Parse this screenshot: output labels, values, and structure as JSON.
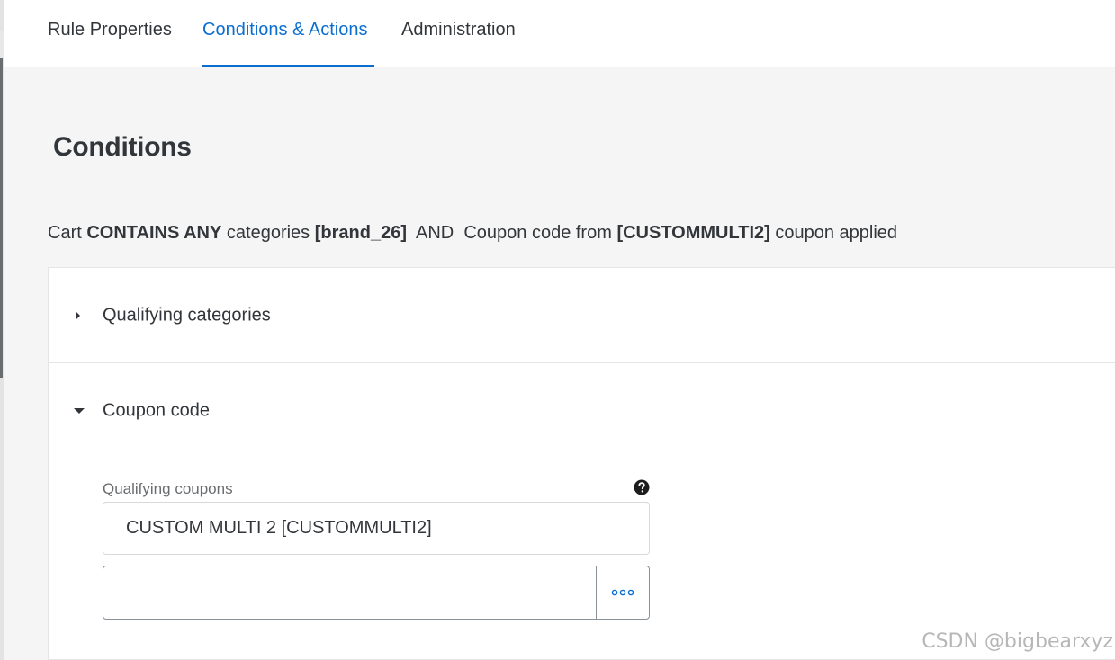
{
  "tabs": [
    {
      "label": "Rule Properties",
      "active": false
    },
    {
      "label": "Conditions & Actions",
      "active": true
    },
    {
      "label": "Administration",
      "active": false
    }
  ],
  "section": {
    "title": "Conditions"
  },
  "summary": {
    "p1": "Cart ",
    "b1": "CONTAINS ANY",
    "p2": " categories ",
    "b2": "[brand_26]",
    "p3": "  AND  Coupon code from ",
    "b3": "[CUSTOMMULTI2]",
    "p4": " coupon applied"
  },
  "groups": [
    {
      "label": "Qualifying categories",
      "expanded": false
    },
    {
      "label": "Coupon code",
      "expanded": true
    }
  ],
  "coupon": {
    "field_label": "Qualifying coupons",
    "selected_value": "CUSTOM MULTI 2 [CUSTOMMULTI2]",
    "input_value": "",
    "more_icon": "ellipsis-icon",
    "help_icon": "question-circle-icon"
  },
  "watermark": "CSDN @bigbearxyz",
  "colors": {
    "accent": "#0a6ed1",
    "text": "#32363a",
    "background": "#f5f5f5"
  }
}
